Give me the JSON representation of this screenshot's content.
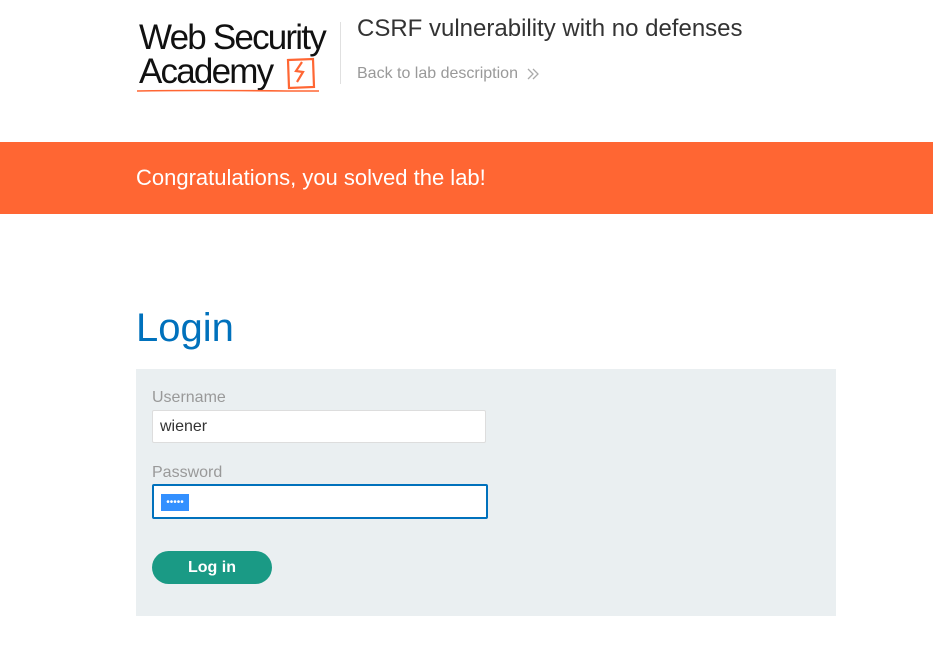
{
  "header": {
    "logo": {
      "line1": "Web Security",
      "line2": "Academy",
      "accent_color": "#ff6633"
    },
    "lab_title": "CSRF vulnerability with no defenses",
    "back_link": "Back to lab description",
    "back_link_icon": "double-chevron-right-icon"
  },
  "banner": {
    "text": "Congratulations, you solved the lab!",
    "color": "#ff6633"
  },
  "main": {
    "title": "Login",
    "title_color": "#0071bc",
    "form": {
      "username_label": "Username",
      "username_value": "wiener",
      "password_label": "Password",
      "password_mask": "•••••",
      "submit_label": "Log in",
      "submit_color": "#1a9a85",
      "panel_color": "#eaeff1"
    }
  }
}
